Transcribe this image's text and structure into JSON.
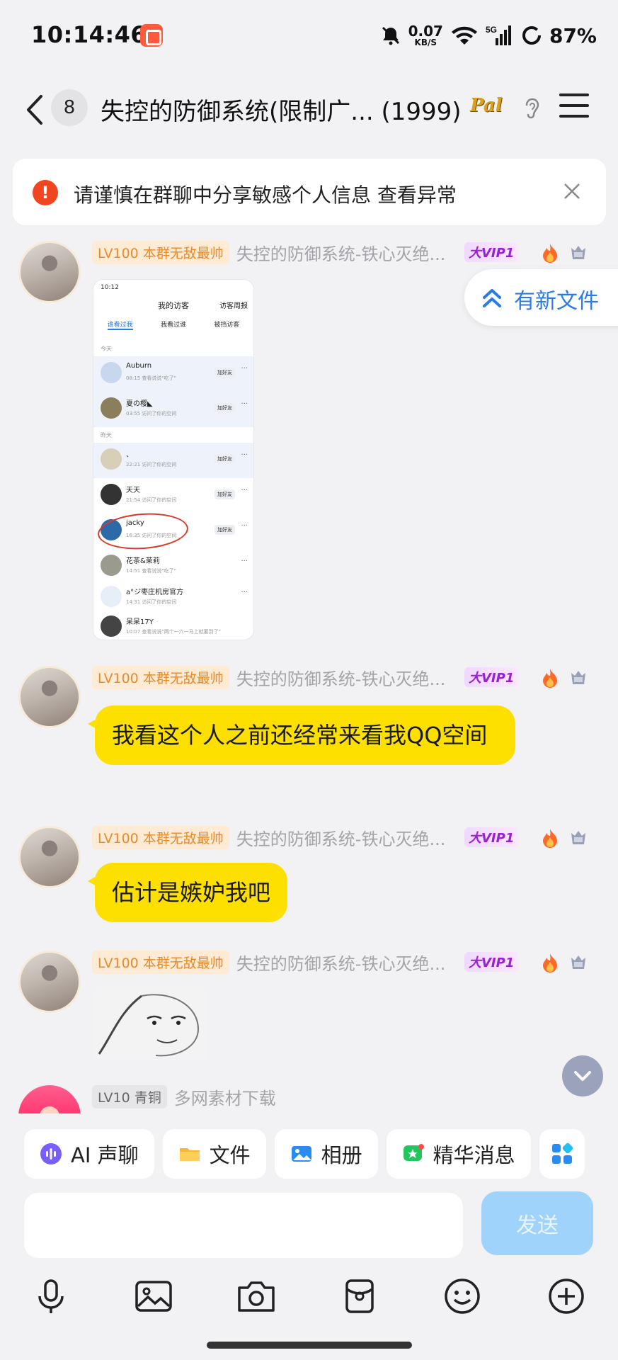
{
  "status_bar": {
    "time": "10:14:46",
    "net_speed": "0.07",
    "net_speed_unit": "KB/S",
    "network": "5G",
    "battery": "87%"
  },
  "header": {
    "member_count": "8",
    "title": "失控的防御系统(限制广... (1999)",
    "logo_text": "Pal"
  },
  "warning": {
    "text": "请谨慎在群聊中分享敏感个人信息 查看异常"
  },
  "new_file": {
    "label": "有新文件"
  },
  "messages": [
    {
      "level": "LV100 本群无敌最帅",
      "nickname": "失控的防御系统-铁心灭绝...",
      "vip": "大VIP1",
      "type": "image"
    },
    {
      "level": "LV100 本群无敌最帅",
      "nickname": "失控的防御系统-铁心灭绝...",
      "vip": "大VIP1",
      "type": "text",
      "text": "我看这个人之前还经常来看我QQ空间"
    },
    {
      "level": "LV100 本群无敌最帅",
      "nickname": "失控的防御系统-铁心灭绝...",
      "vip": "大VIP1",
      "type": "text",
      "text": "估计是嫉妒我吧"
    },
    {
      "level": "LV100 本群无敌最帅",
      "nickname": "失控的防御系统-铁心灭绝...",
      "vip": "大VIP1",
      "type": "sticker"
    },
    {
      "level": "LV10 青铜",
      "nickname": "多网素材下载",
      "type": "partial"
    }
  ],
  "screenshot": {
    "time": "10:12",
    "title": "我的访客",
    "right": "访客周报",
    "tabs": [
      "谁看过我",
      "我看过谁",
      "被挡访客"
    ],
    "section_today": "今天",
    "section_yesterday": "昨天",
    "add_friend": "加好友",
    "rows": [
      {
        "name": "Auburn",
        "sub": "08:15 查看说说\"吃了\""
      },
      {
        "name": "夏の樱◣",
        "sub": "03:55 访问了你的空间"
      },
      {
        "name": "、",
        "sub": "22:21 访问了你的空间"
      },
      {
        "name": "天天",
        "sub": "21:54 访问了你的空间"
      },
      {
        "name": "jacky",
        "sub": "16:35 访问了你的空间"
      },
      {
        "name": "花茶&茉莉",
        "sub": "14:51 查看说说\"吃了\""
      },
      {
        "name": "a°ジ枣庄机房官方",
        "sub": "14:31 访问了你的空间"
      },
      {
        "name": "呆呆17Y",
        "sub": "10:07 查看说说\"两个一六一马上就要到了\""
      }
    ]
  },
  "quick_actions": [
    {
      "label": "AI 声聊",
      "icon": "ai-voice-icon",
      "color": "#7b5cff"
    },
    {
      "label": "文件",
      "icon": "folder-icon",
      "color": "#f7b733"
    },
    {
      "label": "相册",
      "icon": "album-icon",
      "color": "#2a8cf0"
    },
    {
      "label": "精华消息",
      "icon": "essence-icon",
      "color": "#22c55e"
    }
  ],
  "composer": {
    "send_label": "发送"
  },
  "colors": {
    "bubble": "#fde000",
    "accent": "#2a7ae8",
    "warning": "#f0451f",
    "send_disabled": "#9fd3fb"
  }
}
